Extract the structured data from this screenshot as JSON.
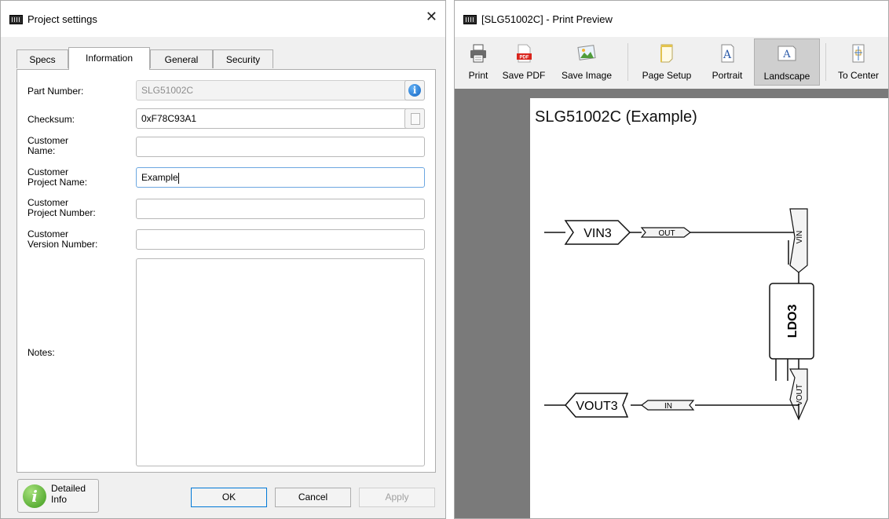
{
  "dialog": {
    "title": "Project settings",
    "tabs": [
      "Specs",
      "Information",
      "General",
      "Security"
    ],
    "active_tab": "Information",
    "fields": {
      "part_number": {
        "label": "Part Number:",
        "value": "SLG51002C"
      },
      "checksum": {
        "label": "Checksum:",
        "value": "0xF78C93A1"
      },
      "customer_name": {
        "label_line1": "Customer",
        "label_line2": "Name:",
        "value": ""
      },
      "customer_project_name": {
        "label_line1": "Customer",
        "label_line2": "Project Name:",
        "value": "Example"
      },
      "customer_project_number": {
        "label_line1": "Customer",
        "label_line2": "Project Number:",
        "value": ""
      },
      "customer_version_number": {
        "label_line1": "Customer",
        "label_line2": "Version Number:",
        "value": ""
      },
      "notes": {
        "label": "Notes:",
        "value": ""
      }
    },
    "buttons": {
      "detailed_line1": "Detailed",
      "detailed_line2": "Info",
      "ok": "OK",
      "cancel": "Cancel",
      "apply": "Apply"
    },
    "icons": {
      "info": "info-icon",
      "copy": "copy-icon",
      "detailed": "info-green-icon"
    },
    "close_glyph": "✕"
  },
  "preview": {
    "title": "[SLG51002C] - Print Preview",
    "toolbar": [
      {
        "label": "Print",
        "icon": "printer-icon"
      },
      {
        "label": "Save PDF",
        "icon": "pdf-icon"
      },
      {
        "label": "Save Image",
        "icon": "image-icon"
      },
      {
        "label": "Page Setup",
        "icon": "page-setup-icon"
      },
      {
        "label": "Portrait",
        "icon": "portrait-icon"
      },
      {
        "label": "Landscape",
        "icon": "landscape-icon",
        "pressed": true
      },
      {
        "label": "To Center",
        "icon": "center-icon"
      }
    ],
    "page_title": "SLG51002C (Example)",
    "schematic": {
      "input_port": "VIN3",
      "input_wire_label": "OUT",
      "block_label": "LDO3",
      "block_pin_top": "VIN",
      "block_pin_bottom": "VOUT",
      "output_port": "VOUT3",
      "output_wire_label": "IN"
    },
    "colors": {
      "canvas_bg": "#7a7a7a",
      "page_bg": "#ffffff",
      "accent": "#0078d7"
    }
  }
}
